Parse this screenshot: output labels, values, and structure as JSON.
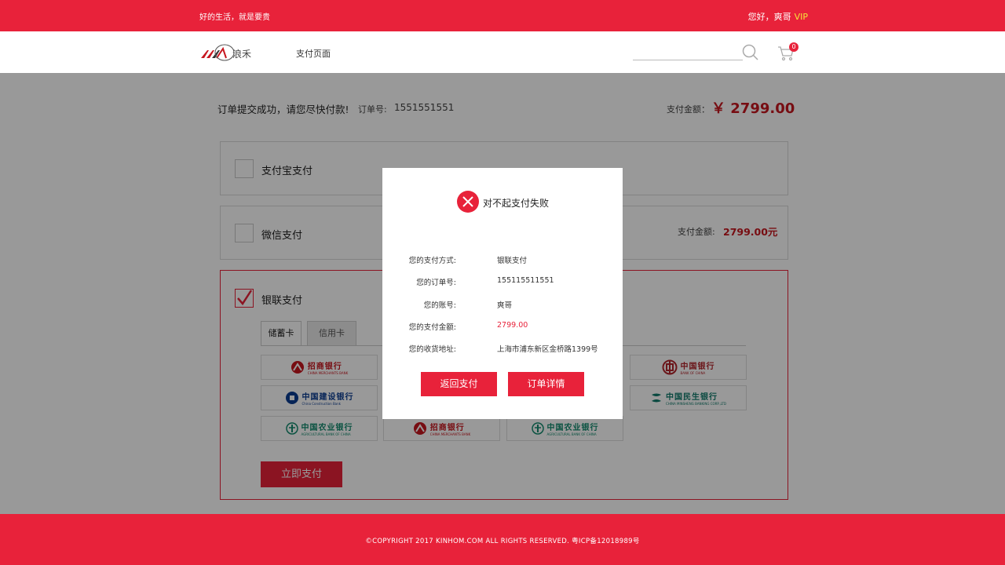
{
  "topbar": {
    "slogan": "好的生活，就是要贵",
    "greeting": "您好，爽哥",
    "vip": "VIP"
  },
  "header": {
    "logo_text": "浪禾",
    "nav_title": "支付页面",
    "search": {
      "placeholder": ""
    },
    "cart_count": "0"
  },
  "order": {
    "message": "订单提交成功，请您尽快付款!",
    "order_no_label": "订单号:",
    "order_no": "1551551551",
    "amount_label": "支付金额：",
    "amount": "￥ 2799.00"
  },
  "methods": {
    "alipay": {
      "label": "支付宝支付"
    },
    "wechat": {
      "label": "微信支付",
      "amount_label": "支付金额:",
      "amount": "2799.00元"
    },
    "union": {
      "label": "银联支付",
      "tabs": [
        {
          "label": "储蓄卡"
        },
        {
          "label": "信用卡"
        }
      ],
      "banks": [
        {
          "name": "招商银行",
          "en": "CHINA MERCHANTS BANK",
          "color": "#c7161f"
        },
        {
          "name": "中国银行",
          "en": "BANK OF CHINA",
          "color": "#b3252c"
        },
        {
          "name": "中国建设银行",
          "en": "China Construction Bank",
          "color": "#0b3d91"
        },
        {
          "name": "中国民生银行",
          "en": "CHINA MINSHENG BANKING CORP.,LTD",
          "color": "#0f7a6b"
        },
        {
          "name": "中国农业银行",
          "en": "AGRICULTURAL BANK OF CHINA",
          "color": "#138a6e"
        },
        {
          "name": "招商银行",
          "en": "CHINA MERCHANTS BANK",
          "color": "#c7161f"
        },
        {
          "name": "中国农业银行",
          "en": "AGRICULTURAL BANK OF CHINA",
          "color": "#138a6e"
        }
      ],
      "pay_now": "立即支付"
    }
  },
  "modal": {
    "title": "对不起支付失败",
    "rows": [
      {
        "label": "您的支付方式:",
        "value": "银联支付"
      },
      {
        "label": "您的订单号:",
        "value": "155115511551"
      },
      {
        "label": "您的账号:",
        "value": "爽哥"
      },
      {
        "label": "您的支付金额:",
        "value": "2799.00"
      },
      {
        "label": "您的收货地址:",
        "value": "上海市浦东新区金桥路1399号"
      }
    ],
    "back_button": "返回支付",
    "detail_button": "订单详情"
  },
  "footer": {
    "copyright": "©COPYRIGHT 2017 KINHOM.COM ALL RIGHTS RESERVED. 粤ICP备12018989号"
  },
  "colors": {
    "brand": "#e8223a",
    "price": "#c7161f",
    "vip": "#f5e43a"
  }
}
